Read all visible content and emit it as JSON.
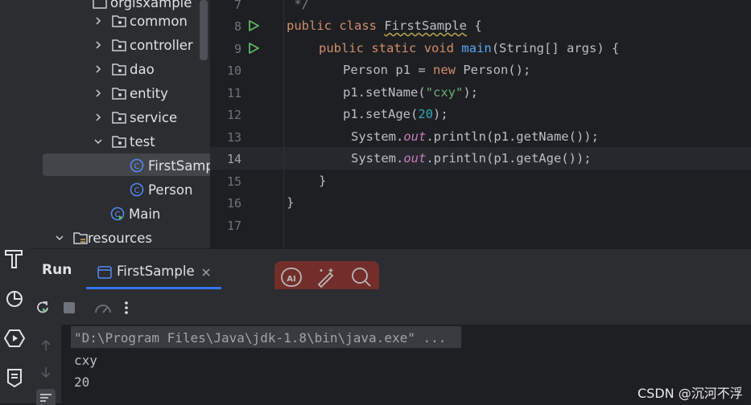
{
  "project_tree": {
    "partial_top": "orgisxample",
    "items": [
      {
        "label": "common",
        "type": "folder"
      },
      {
        "label": "controller",
        "type": "folder"
      },
      {
        "label": "dao",
        "type": "folder"
      },
      {
        "label": "entity",
        "type": "folder"
      },
      {
        "label": "service",
        "type": "folder"
      },
      {
        "label": "test",
        "type": "folder-open"
      },
      {
        "label": "FirstSamp",
        "type": "class"
      },
      {
        "label": "Person",
        "type": "class"
      },
      {
        "label": "Main",
        "type": "main-class"
      },
      {
        "label": "resources",
        "type": "resources-folder"
      }
    ]
  },
  "editor": {
    "line_numbers": [
      "7",
      "8",
      "9",
      "10",
      "11",
      "12",
      "13",
      "14",
      "15",
      "16",
      "17"
    ],
    "active_line": "14",
    "lines": {
      "l7": " */",
      "l8": {
        "kw1": "public",
        "kw2": "class",
        "name": "FirstSample",
        "rest": " {"
      },
      "l9": {
        "kw1": "public",
        "kw2": "static",
        "kw3": "void",
        "fn": "main",
        "rest": "(String[] args) {"
      },
      "l10": {
        "a": "Person p1 = ",
        "kw": "new",
        "b": " Person();"
      },
      "l11": {
        "a": "p1.setName(",
        "str": "\"cxy\"",
        "b": ");"
      },
      "l12": {
        "a": "p1.setAge(",
        "num": "20",
        "b": ");"
      },
      "l13": {
        "a": "System.",
        "st": "out",
        "b": ".println(p1.getName());"
      },
      "l14": {
        "a": "System.",
        "st": "out",
        "b": ".println(p1.getAge());"
      },
      "l15": "}",
      "l16": "}"
    }
  },
  "run_panel": {
    "title": "Run",
    "tab_label": "FirstSample",
    "console": {
      "command": "\"D:\\Program Files\\Java\\jdk-1.8\\bin\\java.exe\" ...",
      "output_1": "cxy",
      "output_2": "20"
    }
  },
  "watermark": "CSDN @沉河不浮",
  "colors": {
    "keyword": "#cf8e6d",
    "function": "#56a8f5",
    "string": "#6aab73",
    "number": "#2aacb8",
    "static_field": "#c77dbb",
    "accent": "#3574f0",
    "run_green": "#5fb865"
  }
}
